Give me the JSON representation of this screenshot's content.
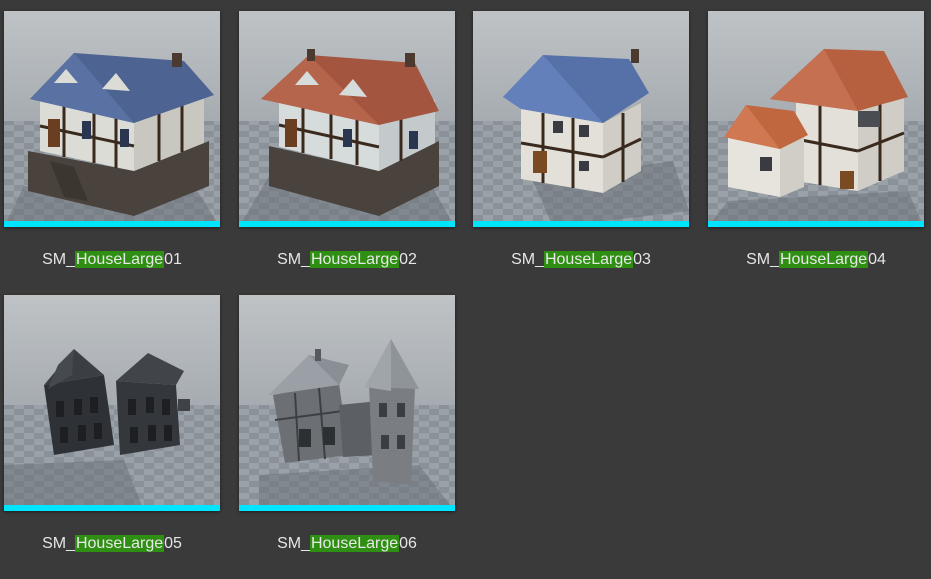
{
  "highlight_color": "#2f8f12",
  "type_bar_color": "#00e5ff",
  "assets": [
    {
      "prefix": "SM_",
      "match": "HouseLarge",
      "suffix": "01",
      "style": "blue-roof-stone-base"
    },
    {
      "prefix": "SM_",
      "match": "HouseLarge",
      "suffix": "02",
      "style": "red-roof-stone-base"
    },
    {
      "prefix": "SM_",
      "match": "HouseLarge",
      "suffix": "03",
      "style": "blue-roof-timber"
    },
    {
      "prefix": "SM_",
      "match": "HouseLarge",
      "suffix": "04",
      "style": "orange-roof-timber"
    },
    {
      "prefix": "SM_",
      "match": "HouseLarge",
      "suffix": "05",
      "style": "untextured-dark"
    },
    {
      "prefix": "SM_",
      "match": "HouseLarge",
      "suffix": "06",
      "style": "untextured-tower"
    }
  ]
}
